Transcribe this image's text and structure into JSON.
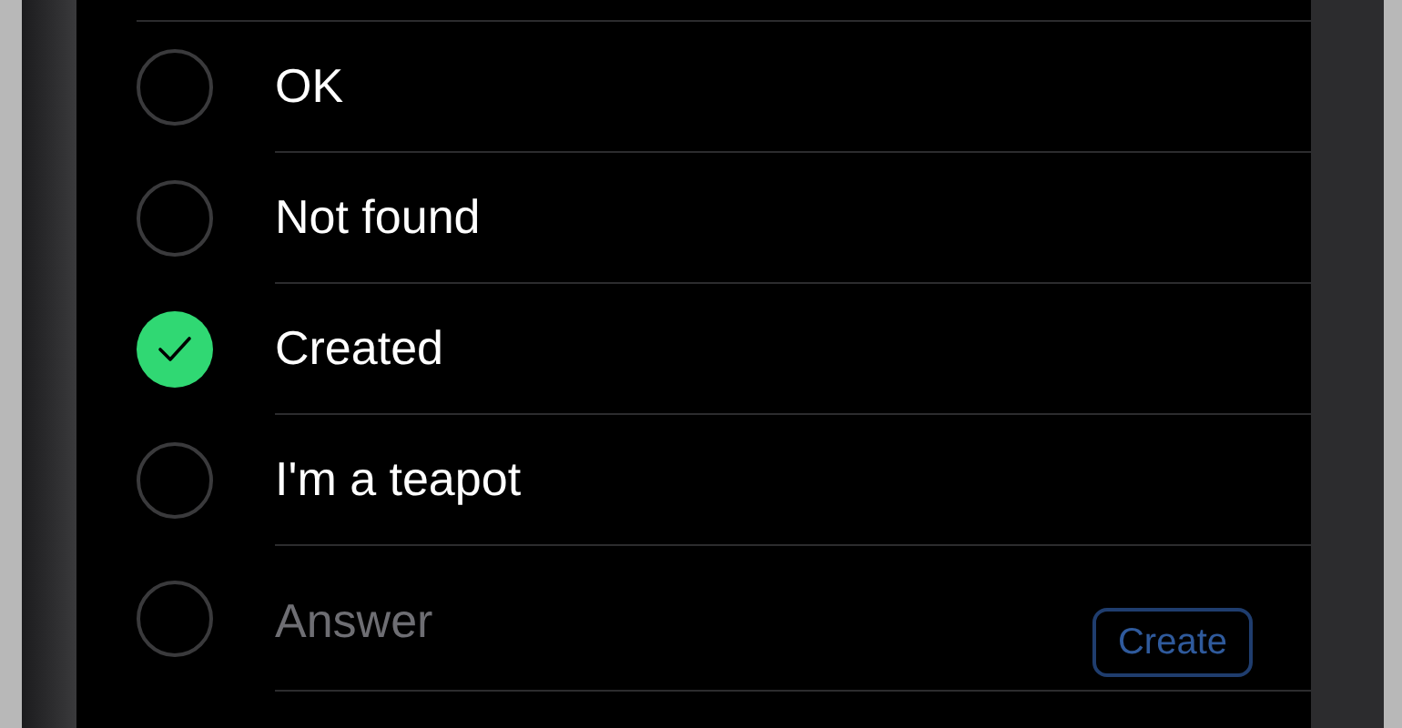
{
  "options": [
    {
      "label": "OK",
      "selected": false
    },
    {
      "label": "Not found",
      "selected": false
    },
    {
      "label": "Created",
      "selected": true
    },
    {
      "label": "I'm a teapot",
      "selected": false
    }
  ],
  "new_option": {
    "placeholder": "Answer",
    "selected": false,
    "button": {
      "label": "Create",
      "disabled": true
    }
  }
}
